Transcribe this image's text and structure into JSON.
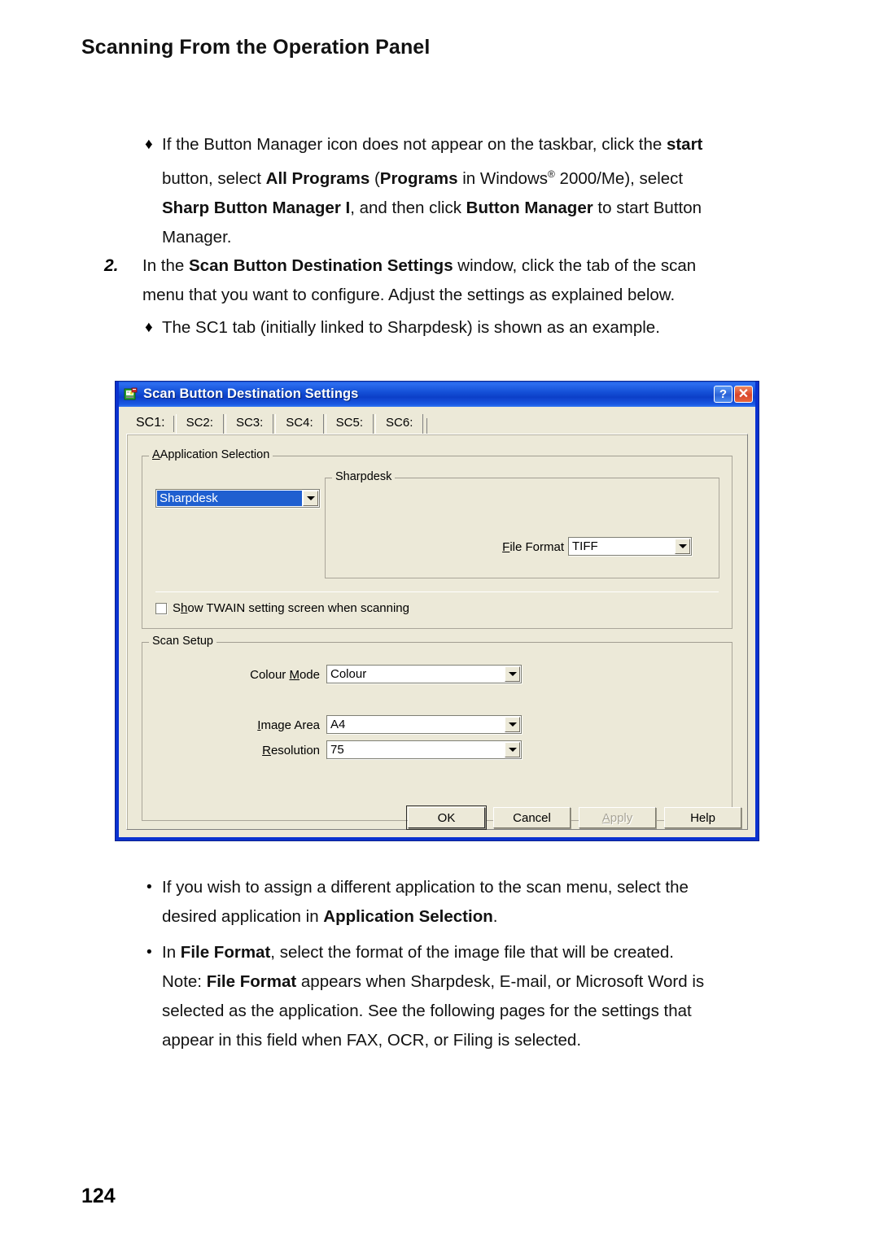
{
  "page": {
    "header": "Scanning From the Operation Panel",
    "number": "124"
  },
  "content": {
    "bullet1_marker": "♦",
    "bullet1_line1_a": "If the Button Manager icon does not appear on the taskbar, click the ",
    "bullet1_line1_b": "start",
    "bullet1_line2_a": "button, select ",
    "bullet1_line2_b": "All Programs",
    "bullet1_line2_c": " (",
    "bullet1_line2_d": "Programs",
    "bullet1_line2_e": " in Windows",
    "bullet1_line2_r": "®",
    "bullet1_line2_f": " 2000/Me), select",
    "bullet1_line3_a": "Sharp Button Manager I",
    "bullet1_line3_b": ", and then click ",
    "bullet1_line3_c": "Button Manager",
    "bullet1_line3_d": " to start Button",
    "bullet1_line4": "Manager.",
    "step2_number": "2.",
    "step2_line1_a": "In the ",
    "step2_line1_b": "Scan Button Destination Settings",
    "step2_line1_c": " window, click the tab of the scan",
    "step2_line2": "menu that you want to configure. Adjust the settings as explained below.",
    "bullet2_marker": "♦",
    "bullet2_text": "The SC1 tab (initially linked to Sharpdesk) is shown as an example.",
    "bullet3_marker": "•",
    "bullet3_line1": "If you wish to assign a different application to the scan menu, select the",
    "bullet3_line2_a": "desired application in ",
    "bullet3_line2_b": "Application Selection",
    "bullet3_line2_c": ".",
    "bullet4_marker": "•",
    "bullet4_line1_a": "In ",
    "bullet4_line1_b": "File Format",
    "bullet4_line1_c": ", select the format of the image file that will be created.",
    "bullet4_line2_a": "Note: ",
    "bullet4_line2_b": "File Format",
    "bullet4_line2_c": " appears when Sharpdesk, E-mail, or Microsoft Word is",
    "bullet4_line3": "selected as the application. See the following pages for the settings that",
    "bullet4_line4": "appear in this field when FAX, OCR, or Filing is selected."
  },
  "dialog": {
    "title": "Scan Button Destination Settings",
    "icon": "scan-settings-icon",
    "help_button": "?",
    "close_button": "✕",
    "tabs": [
      {
        "label": "SC1:",
        "active": true
      },
      {
        "label": "SC2:",
        "active": false
      },
      {
        "label": "SC3:",
        "active": false
      },
      {
        "label": "SC4:",
        "active": false
      },
      {
        "label": "SC5:",
        "active": false
      },
      {
        "label": "SC6:",
        "active": false
      }
    ],
    "application_selection": {
      "legend": "Application Selection",
      "legend_mnemonic": "A",
      "combo_value": "Sharpdesk",
      "combo_selected": true
    },
    "sharpdesk_group": {
      "legend": "Sharpdesk",
      "file_format_label": "File Format",
      "file_format_mnemonic": "F",
      "file_format_value": "TIFF"
    },
    "twain_checkbox": {
      "label": "Show TWAIN setting screen when scanning",
      "label_pre": "S",
      "label_mnemonic": "h",
      "label_post": "ow TWAIN setting screen when scanning",
      "checked": false
    },
    "scan_setup": {
      "legend": "Scan Setup",
      "fields": [
        {
          "label_pre": "Colour ",
          "label_mnemonic": "M",
          "label_post": "ode",
          "value": "Colour"
        },
        {
          "label_pre": "",
          "label_mnemonic": "I",
          "label_post": "mage Area",
          "value": "A4"
        },
        {
          "label_pre": "",
          "label_mnemonic": "R",
          "label_post": "esolution",
          "value": "75"
        }
      ]
    },
    "buttons": [
      {
        "label": "OK",
        "state": "default"
      },
      {
        "label": "Cancel",
        "state": "normal"
      },
      {
        "label": "Apply",
        "state": "disabled",
        "mnemonic": "A"
      },
      {
        "label": "Help",
        "state": "normal"
      }
    ]
  }
}
